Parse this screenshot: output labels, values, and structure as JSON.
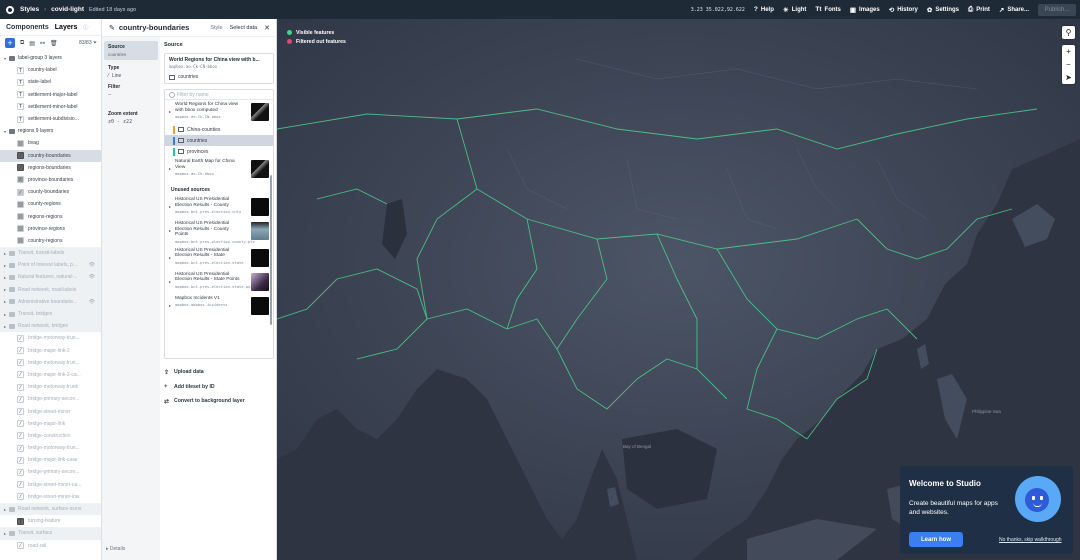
{
  "topbar": {
    "styles_label": "Styles",
    "style_name": "covid-light",
    "edited": "Edited 18 days ago",
    "coords": "3.23 35.022,92.622",
    "items": [
      {
        "icon": "help-icon",
        "glyph": "?",
        "label": "Help"
      },
      {
        "icon": "light-icon",
        "glyph": "☀",
        "label": "Light"
      },
      {
        "icon": "fonts-icon",
        "glyph": "Tt",
        "label": "Fonts"
      },
      {
        "icon": "images-icon",
        "glyph": "▣",
        "label": "Images"
      },
      {
        "icon": "history-icon",
        "glyph": "⟲",
        "label": "History"
      },
      {
        "icon": "settings-icon",
        "glyph": "✿",
        "label": "Settings"
      },
      {
        "icon": "print-icon",
        "glyph": "⎙",
        "label": "Print"
      },
      {
        "icon": "share-icon",
        "glyph": "↗",
        "label": "Share..."
      }
    ],
    "publish": "Publish..."
  },
  "left": {
    "tab_components": "Components",
    "tab_layers": "Layers",
    "count": "83/83",
    "rows": [
      {
        "kind": "group",
        "label": "label-group 3 layers"
      },
      {
        "kind": "layer",
        "icon": "T",
        "label": "country-label"
      },
      {
        "kind": "layer",
        "icon": "T",
        "label": "state-label"
      },
      {
        "kind": "layer",
        "icon": "T",
        "label": "settlement-major-label"
      },
      {
        "kind": "layer",
        "icon": "T",
        "label": "settlement-minor-label"
      },
      {
        "kind": "layer",
        "icon": "T",
        "label": "settlement-subdivisio..."
      },
      {
        "kind": "group",
        "label": "regions 9 layers"
      },
      {
        "kind": "layer",
        "icon": "fill",
        "label": "bvag"
      },
      {
        "kind": "layer",
        "icon": "line",
        "label": "country-boundaries",
        "selected": true
      },
      {
        "kind": "layer",
        "icon": "line",
        "label": "regions-boundaries"
      },
      {
        "kind": "layer",
        "icon": "line",
        "label": "province-boundaries"
      },
      {
        "kind": "layer",
        "icon": "line",
        "label": "county-boundaries"
      },
      {
        "kind": "layer",
        "icon": "fill",
        "label": "county-regions"
      },
      {
        "kind": "layer",
        "icon": "fill",
        "label": "regions-regions"
      },
      {
        "kind": "layer",
        "icon": "fill",
        "label": "province-regions"
      },
      {
        "kind": "layer",
        "icon": "fill",
        "label": "country-regions"
      },
      {
        "kind": "group",
        "label": "Transit, transit-labels",
        "dim": true
      },
      {
        "kind": "group",
        "label": "Point of interest labels, p...",
        "dim": true,
        "eye": true
      },
      {
        "kind": "group",
        "label": "Natural features, natural-...",
        "dim": true,
        "eye": true
      },
      {
        "kind": "group",
        "label": "Road network, road-labels",
        "dim": true
      },
      {
        "kind": "group",
        "label": "Administrative boundarie...",
        "dim": true,
        "eye": true
      },
      {
        "kind": "group",
        "label": "Transit, bridges",
        "dim": true
      },
      {
        "kind": "group",
        "label": "Road network, bridges",
        "dim": true
      },
      {
        "kind": "layer",
        "icon": "line",
        "label": "bridge-motorway-trun...",
        "dim": true
      },
      {
        "kind": "layer",
        "icon": "line",
        "label": "bridge-major-link-2",
        "dim": true
      },
      {
        "kind": "layer",
        "icon": "line",
        "label": "bridge-motorway-trun...",
        "dim": true
      },
      {
        "kind": "layer",
        "icon": "line",
        "label": "bridge-major-link-2-ca...",
        "dim": true
      },
      {
        "kind": "layer",
        "icon": "line",
        "label": "bridge-motorway-trunk",
        "dim": true
      },
      {
        "kind": "layer",
        "icon": "line",
        "label": "bridge-primary-secon...",
        "dim": true
      },
      {
        "kind": "layer",
        "icon": "line",
        "label": "bridge-street-minor",
        "dim": true
      },
      {
        "kind": "layer",
        "icon": "line",
        "label": "bridge-major-link",
        "dim": true
      },
      {
        "kind": "layer",
        "icon": "line",
        "label": "bridge-construction",
        "dim": true
      },
      {
        "kind": "layer",
        "icon": "line",
        "label": "bridge-motorway-trun...",
        "dim": true
      },
      {
        "kind": "layer",
        "icon": "line",
        "label": "bridge-major-link-case",
        "dim": true
      },
      {
        "kind": "layer",
        "icon": "line",
        "label": "bridge-primary-secon...",
        "dim": true
      },
      {
        "kind": "layer",
        "icon": "line",
        "label": "bridge-street-minor-ca...",
        "dim": true
      },
      {
        "kind": "layer",
        "icon": "line",
        "label": "bridge-street-minor-low",
        "dim": true
      },
      {
        "kind": "group",
        "label": "Road network, surface-icons",
        "dim": true
      },
      {
        "kind": "layer",
        "icon": "T",
        "label": "turning-feature",
        "dim": true
      },
      {
        "kind": "group",
        "label": "Transit, surface",
        "dim": true
      },
      {
        "kind": "layer",
        "icon": "line",
        "label": "road-rail",
        "dim": true
      }
    ]
  },
  "editor": {
    "title": "country-boundaries",
    "tab_style": "Style",
    "tab_select": "Select data",
    "source_label": "Source",
    "source_value": "countries",
    "type_label": "Type",
    "type_value": "Line",
    "filter_label": "Filter",
    "filter_value": "--",
    "zoom_label": "Zoom extent",
    "zoom_value": "z0 - z22",
    "current": {
      "name": "World Regions for China view with b...",
      "id": "mapbox.ao-Ck-CN-bbox",
      "layer": "countries"
    },
    "filter_placeholder": "Filter by name",
    "sources_used": [
      {
        "name": "World Regions for China view with bbox computed",
        "id": "mapbox.ao-Ck-CN-bbox",
        "thumb": "t1"
      },
      {
        "name": "Natural Earth Map for China View",
        "id": "mapbox.ao-Ck-bbox",
        "thumb": "t1"
      }
    ],
    "sub_layers": [
      {
        "label": "China-counties",
        "color": "#f0a030"
      },
      {
        "label": "countries",
        "color": "#3a7bd5",
        "selected": true
      },
      {
        "label": "provinces",
        "color": "#2fc0a0"
      }
    ],
    "unused_title": "Unused sources",
    "sources_unused": [
      {
        "name": "Historical US Presidential Election Results - County",
        "id": "mapbox.bnt-pres-election-cnty",
        "thumb": "t0"
      },
      {
        "name": "Historical US Presidential Election Results - County Points",
        "id": "mapbox.bnt-pres-election-county-pts",
        "thumb": "t2"
      },
      {
        "name": "Historical US Presidential Election Results - State",
        "id": "mapbox.bnt-pres-election-state",
        "thumb": "t0"
      },
      {
        "name": "Historical US Presidential Election Results - State Points",
        "id": "mapbox.bnt-pres-election-state-points",
        "thumb": "t3"
      },
      {
        "name": "Mapbox Incidents V1",
        "id": "mapbox.mapbox-incidents",
        "thumb": "t0"
      }
    ],
    "actions": [
      {
        "icon": "upload-icon",
        "glyph": "⇪",
        "label": "Upload data"
      },
      {
        "icon": "plus-icon",
        "glyph": "+",
        "label": "Add tileset by ID"
      },
      {
        "icon": "convert-icon",
        "glyph": "⇄",
        "label": "Convert to background layer"
      }
    ],
    "details": "Details"
  },
  "map": {
    "legend": [
      {
        "label": "Visible features",
        "color": "#39d98a"
      },
      {
        "label": "Filtered out features",
        "color": "#e0457b"
      }
    ],
    "controls": [
      "⚲",
      "+",
      "−",
      "➤"
    ],
    "labels": [
      {
        "text": "Bay of Bengal"
      },
      {
        "text": "Philippine Sea"
      }
    ],
    "boundary_color": "#4fd08b"
  },
  "welcome": {
    "title": "Welcome to Studio",
    "desc": "Create beautiful maps for apps and websites.",
    "learn": "Learn how",
    "skip": "No thanks, skip walkthrough"
  }
}
